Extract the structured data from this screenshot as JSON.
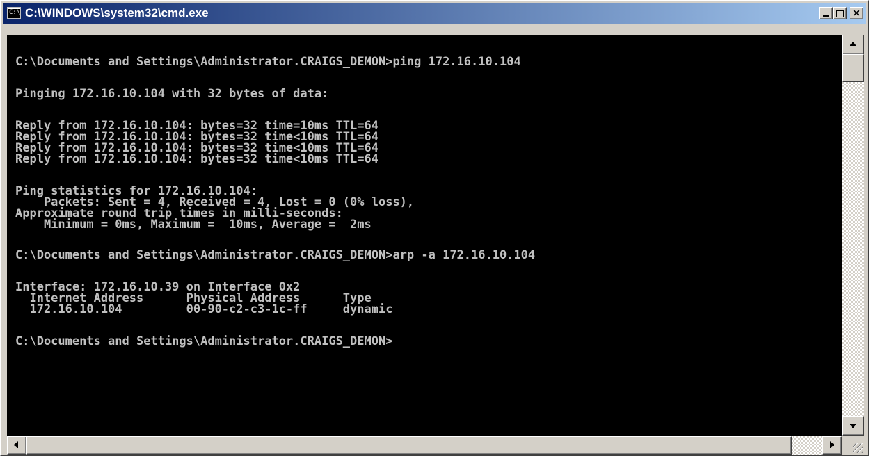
{
  "window": {
    "title": "C:\\WINDOWS\\system32\\cmd.exe"
  },
  "console": {
    "lines": [
      "C:\\Documents and Settings\\Administrator.CRAIGS_DEMON>ping 172.16.10.104",
      "Pinging 172.16.10.104 with 32 bytes of data:",
      "Reply from 172.16.10.104: bytes=32 time=10ms TTL=64",
      "Reply from 172.16.10.104: bytes=32 time<10ms TTL=64",
      "Reply from 172.16.10.104: bytes=32 time<10ms TTL=64",
      "Reply from 172.16.10.104: bytes=32 time<10ms TTL=64",
      "Ping statistics for 172.16.10.104:",
      "    Packets: Sent = 4, Received = 4, Lost = 0 (0% loss),",
      "Approximate round trip times in milli-seconds:",
      "    Minimum = 0ms, Maximum =  10ms, Average =  2ms",
      "C:\\Documents and Settings\\Administrator.CRAIGS_DEMON>arp -a 172.16.10.104",
      "Interface: 172.16.10.39 on Interface 0x2",
      "  Internet Address      Physical Address      Type",
      "  172.16.10.104         00-90-c2-c3-1c-ff     dynamic",
      "C:\\Documents and Settings\\Administrator.CRAIGS_DEMON>"
    ]
  },
  "colors": {
    "console_bg": "#000000",
    "console_text": "#c0c0c0",
    "titlebar_start": "#0a246a",
    "titlebar_end": "#a6caf0"
  },
  "icons": {
    "app": "command-prompt-icon",
    "minimize": "minimize-icon",
    "maximize": "maximize-icon",
    "close": "close-icon",
    "up": "arrow-up-icon",
    "down": "arrow-down-icon",
    "left": "arrow-left-icon",
    "right": "arrow-right-icon",
    "grip": "resize-grip-icon"
  }
}
